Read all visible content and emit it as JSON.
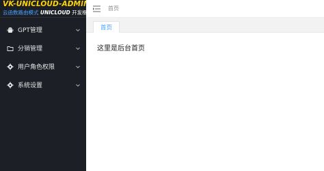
{
  "logo": {
    "title": "VK-UNICLOUD-ADMIN",
    "subtitle_cn": "云函数路由模式",
    "subtitle_brand": "UNICLOUD",
    "subtitle_suffix": "开发框架"
  },
  "sidebar": {
    "items": [
      {
        "label": "GPT管理",
        "icon": "android-icon"
      },
      {
        "label": "分销管理",
        "icon": "folder-icon"
      },
      {
        "label": "用户角色权限",
        "icon": "gear-icon"
      },
      {
        "label": "系统设置",
        "icon": "gear-icon"
      }
    ]
  },
  "header": {
    "breadcrumb": "首页"
  },
  "tabs": [
    {
      "label": "首页",
      "active": true
    }
  ],
  "main": {
    "content_text": "这里是后台首页"
  },
  "colors": {
    "sidebar_bg": "#1c1f25",
    "logo_yellow": "#ffd400",
    "accent_blue": "#409eff"
  }
}
